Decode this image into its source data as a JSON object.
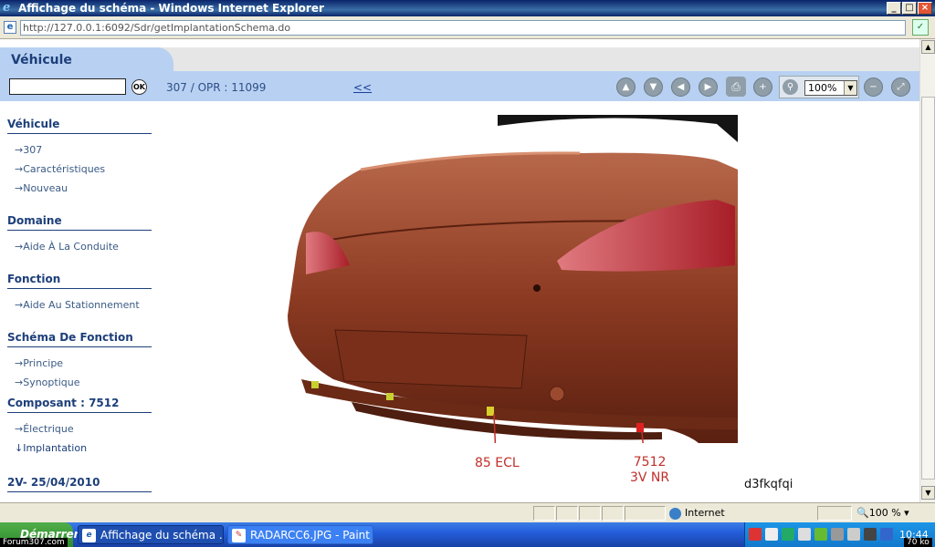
{
  "window": {
    "title": "Affichage du schéma - Windows Internet Explorer",
    "minimize_icon": "_",
    "maximize_icon": "□",
    "close_icon": "×"
  },
  "addressbar": {
    "url": "http://127.0.0.1:6092/Sdr/getImplantationSchema.do"
  },
  "app": {
    "tab_title": "Véhicule",
    "ok_label": "OK",
    "vehicle_info": "307  /  OPR : 11099",
    "back_link": "<<",
    "zoom_value": "100%",
    "toolbar_icons": [
      "up-arrow-icon",
      "down-arrow-icon",
      "left-arrow-icon",
      "right-arrow-icon",
      "print-icon",
      "zoom-in-icon",
      "magnifier-icon",
      "zoom-out-icon",
      "fit-to-screen-icon"
    ]
  },
  "sidebar": {
    "sections": [
      {
        "title": "Véhicule",
        "items": [
          "307",
          "Caractéristiques",
          "Nouveau"
        ]
      },
      {
        "title": "Domaine",
        "items": [
          "Aide À La Conduite"
        ]
      },
      {
        "title": "Fonction",
        "items": [
          "Aide Au Stationnement"
        ]
      },
      {
        "title": "Schéma De Fonction",
        "items": [
          "Principe",
          "Synoptique"
        ]
      },
      {
        "title": "Composant : 7512",
        "items": [
          "Électrique",
          "Implantation"
        ]
      },
      {
        "title": "2V- 25/04/2010",
        "items": []
      }
    ]
  },
  "schema": {
    "callouts": [
      {
        "text": "85 ECL"
      },
      {
        "line1": "7512",
        "line2": "3V NR"
      }
    ],
    "code": "d3fkqfqi",
    "colors": {
      "body": "#8c3a22",
      "highlight": "#c06a4a",
      "lamp": "#b02a30",
      "callout": "#c0302a"
    }
  },
  "statusbar": {
    "zone": "Internet",
    "zoom": "100 %"
  },
  "taskbar": {
    "start_label": "Démarrer",
    "tasks": [
      {
        "label": "Affichage du schéma ..."
      },
      {
        "label": "RADARCC6.JPG - Paint"
      }
    ],
    "clock": "10:44",
    "watermark_left": "Forum307.com",
    "watermark_right": "70 ko"
  }
}
